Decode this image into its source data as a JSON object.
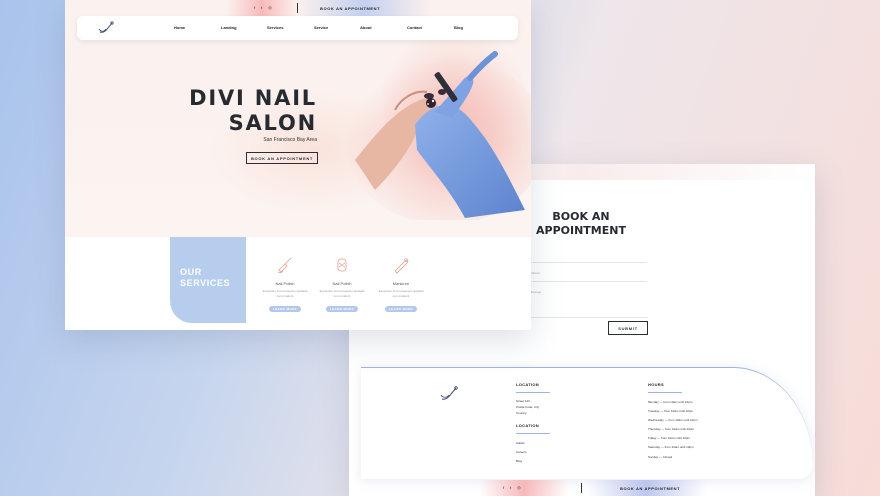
{
  "front": {
    "top_bar": {
      "social_icons": [
        "facebook-icon",
        "twitter-icon",
        "instagram-icon"
      ],
      "social_glyphs": [
        "f",
        "t",
        "◎"
      ],
      "book_label": "BOOK AN APPOINTMENT"
    },
    "nav": {
      "items": [
        "Home",
        "Landing",
        "Services",
        "Service",
        "About",
        "Contact",
        "Blog"
      ]
    },
    "hero": {
      "title_line1": "DIVI NAIL",
      "title_line2": "SALON",
      "subtitle": "San Francisco Bay Area",
      "button_label": "BOOK AN APPOINTMENT"
    },
    "services": {
      "tab_label": "OUR SERVICES",
      "items": [
        {
          "name": "Nail Polish",
          "desc": "Excepteur sint occaecat cupidatat non proident",
          "button": "LEARN MORE",
          "icon": "nail-polish-icon"
        },
        {
          "name": "Nail Polish",
          "desc": "Excepteur sint occaecat cupidatat non proident",
          "button": "LEARN MORE",
          "icon": "nail-art-icon"
        },
        {
          "name": "Manicure",
          "desc": "Excepteur sint occaecat cupidatat non proident",
          "button": "LEARN MORE",
          "icon": "manicure-icon"
        }
      ]
    }
  },
  "back": {
    "booking": {
      "title_line1": "BOOK AN",
      "title_line2": "APPOINTMENT",
      "field_labels": [
        "Address",
        "Message"
      ],
      "submit_label": "SUBMIT"
    },
    "footer": {
      "location_heading": "LOCATION",
      "location_lines": [
        "Street 123,",
        "Postal Code, City",
        "Country"
      ],
      "location2_heading": "LOCATION",
      "links": [
        "Adobe",
        "Careers",
        "Blog"
      ],
      "hours_heading": "HOURS",
      "hours": [
        "Monday — from 10am until 10pm",
        "Tuesday — from 10am until 10pm",
        "Wednesday — from 10am until 10pm",
        "Thursday — from 10am until 10pm",
        "Friday — from 10am until 10pm",
        "Saturday — from 10am until 10pm",
        "Sunday — Closed"
      ]
    },
    "bottom_bar": {
      "social_icons": [
        "facebook-icon",
        "twitter-icon",
        "instagram-icon"
      ],
      "social_glyphs": [
        "f",
        "t",
        "◎"
      ],
      "book_label": "BOOK AN APPOINTMENT"
    }
  },
  "colors": {
    "accent_blue": "#b6cdee",
    "accent_pink": "#f6a8aa",
    "dark_text": "#262a31"
  }
}
